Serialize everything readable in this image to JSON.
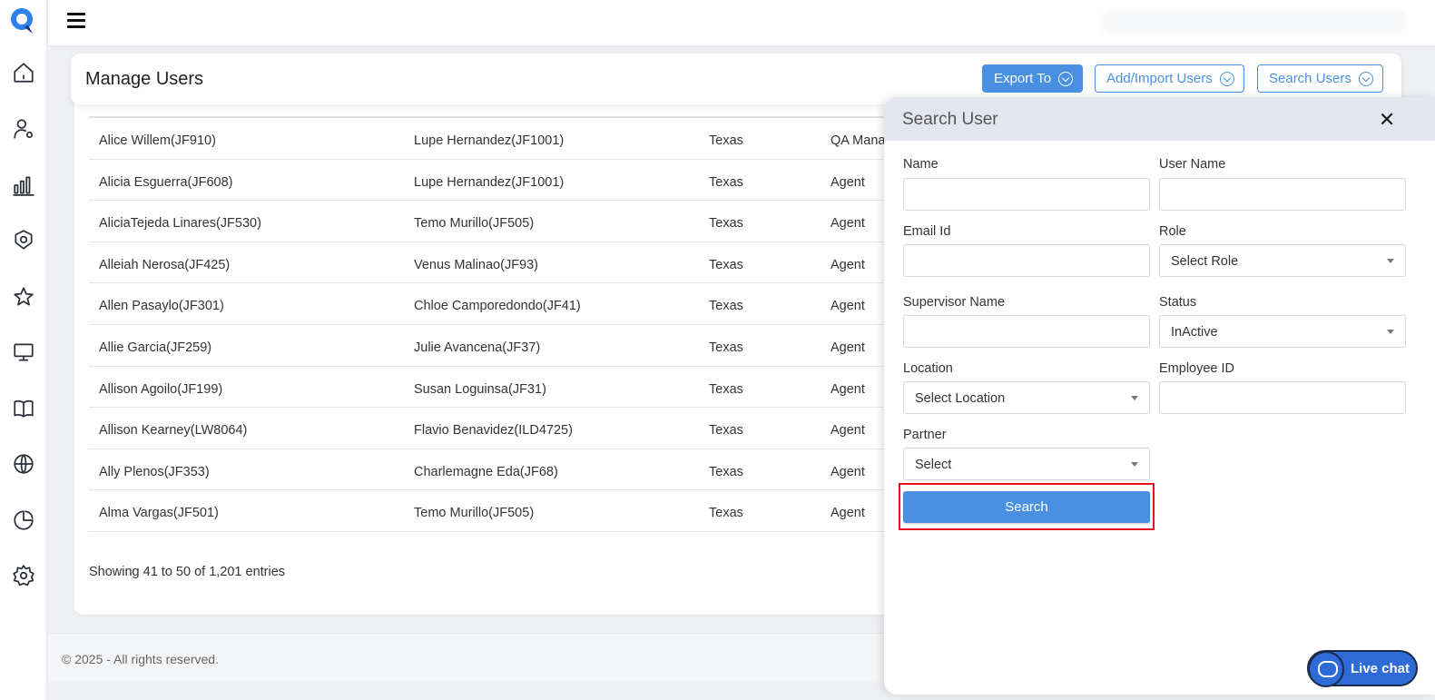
{
  "header": {
    "title": "Manage Users",
    "export_label": "Export To",
    "add_import_label": "Add/Import Users",
    "search_users_label": "Search Users"
  },
  "sidebar": {
    "items": [
      {
        "icon": "home-icon"
      },
      {
        "icon": "user-settings-icon"
      },
      {
        "icon": "bar-chart-icon"
      },
      {
        "icon": "badge-icon"
      },
      {
        "icon": "star-icon"
      },
      {
        "icon": "monitor-icon"
      },
      {
        "icon": "book-icon"
      },
      {
        "icon": "globe-icon"
      },
      {
        "icon": "pie-chart-icon"
      },
      {
        "icon": "gear-icon"
      }
    ]
  },
  "table": {
    "rows": [
      [
        "Alice Willem(JF910)",
        "Lupe Hernandez(JF1001)",
        "Texas",
        "QA Mana"
      ],
      [
        "Alicia Esguerra(JF608)",
        "Lupe Hernandez(JF1001)",
        "Texas",
        "Agent"
      ],
      [
        "AliciaTejeda Linares(JF530)",
        "Temo Murillo(JF505)",
        "Texas",
        "Agent"
      ],
      [
        "Alleiah Nerosa(JF425)",
        "Venus Malinao(JF93)",
        "Texas",
        "Agent"
      ],
      [
        "Allen Pasaylo(JF301)",
        "Chloe Camporedondo(JF41)",
        "Texas",
        "Agent"
      ],
      [
        "Allie Garcia(JF259)",
        "Julie Avancena(JF37)",
        "Texas",
        "Agent"
      ],
      [
        "Allison Agoilo(JF199)",
        "Susan Loguinsa(JF31)",
        "Texas",
        "Agent"
      ],
      [
        "Allison Kearney(LW8064)",
        "Flavio Benavidez(ILD4725)",
        "Texas",
        "Agent"
      ],
      [
        "Ally Plenos(JF353)",
        "Charlemagne Eda(JF68)",
        "Texas",
        "Agent"
      ],
      [
        "Alma Vargas(JF501)",
        "Temo Murillo(JF505)",
        "Texas",
        "Agent"
      ]
    ],
    "entries_text": "Showing 41 to 50 of 1,201 entries"
  },
  "footer": {
    "text": "© 2025 - All rights reserved."
  },
  "search_panel": {
    "title": "Search User",
    "name_label": "Name",
    "name_value": "",
    "username_label": "User Name",
    "username_value": "",
    "email_label": "Email Id",
    "email_value": "",
    "role_label": "Role",
    "role_value": "Select Role",
    "supervisor_label": "Supervisor Name",
    "supervisor_value": "",
    "status_label": "Status",
    "status_value": "InActive",
    "location_label": "Location",
    "location_value": "Select Location",
    "employee_id_label": "Employee ID",
    "employee_id_value": "",
    "partner_label": "Partner",
    "partner_value": "Select",
    "search_button": "Search"
  },
  "livechat": {
    "label": "Live chat"
  },
  "colors": {
    "accent": "#4a90e2",
    "highlight": "#e8141d",
    "chat": "#2e6bd6"
  }
}
